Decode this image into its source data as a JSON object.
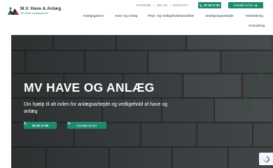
{
  "brand": {
    "name": "M.V. Have & Anlæg",
    "tagline": "Din lokale anlægsgartner",
    "accent_color": "#1f8a70",
    "logo_icon": "landscaper-logo-icon"
  },
  "topbar": {
    "links": [
      "FORSIDE",
      "OM OS",
      "KONTAKT"
    ],
    "phone_label": "20 35 17 50",
    "phone_icon": "phone-icon",
    "contact_label": "Kontakt os her",
    "contact_icon": "arrow-right-icon"
  },
  "nav": {
    "items": [
      "Anlægsgartner",
      "Have Og Anlæg",
      "Pleje- Og Vedligeholdelsesaftale",
      "Belægningsarbejde",
      "Træfældning",
      "Snerydning"
    ]
  },
  "hero": {
    "title": "MV HAVE OG ANLÆG",
    "subtitle": "Din hjælp til alt inden for anlægsarbejde og vedligehold af have og anlæg",
    "phone_label": "20 35 17 50",
    "contact_label": "Kontakt os her"
  },
  "recaptcha": {
    "icon": "recaptcha-icon"
  }
}
